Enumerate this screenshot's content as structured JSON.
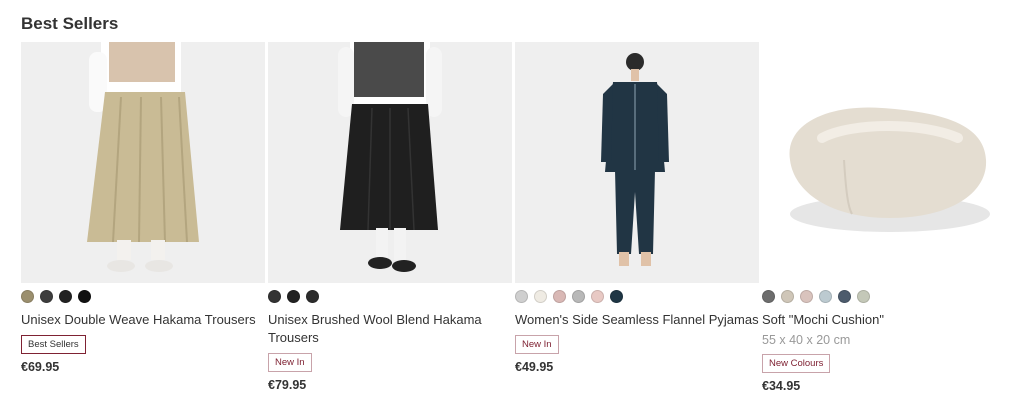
{
  "section": {
    "title": "Best Sellers"
  },
  "products": [
    {
      "name": "Unisex Double Weave Hakama Trousers",
      "swatches": [
        {
          "name": "beige",
          "color": "#9b8f6e"
        },
        {
          "name": "dark-grey",
          "color": "#3d3d3d"
        },
        {
          "name": "black",
          "color": "#222222"
        },
        {
          "name": "black",
          "color": "#111111"
        }
      ],
      "badge": "Best Sellers",
      "price": "€69.95"
    },
    {
      "name": "Unisex Brushed Wool Blend Hakama Trousers",
      "swatches": [
        {
          "name": "charcoal",
          "color": "#333333"
        },
        {
          "name": "black",
          "color": "#222222"
        },
        {
          "name": "dark-grey",
          "color": "#2c2c2c"
        }
      ],
      "badge": "New In",
      "price": "€79.95"
    },
    {
      "name": "Women's Side Seamless Flannel Pyjamas",
      "swatches": [
        {
          "name": "light-grey",
          "color": "#cfcfcf"
        },
        {
          "name": "off-white",
          "color": "#efebe3"
        },
        {
          "name": "pink-check",
          "color": "#d9b8b5"
        },
        {
          "name": "grey-check",
          "color": "#b8b8b8"
        },
        {
          "name": "light-pink",
          "color": "#e8c9c4"
        },
        {
          "name": "navy",
          "color": "#1f3645"
        }
      ],
      "badge": "New In",
      "price": "€49.95"
    },
    {
      "name": "Soft \"Mochi Cushion\"",
      "dims": "55 x 40 x 20 cm",
      "swatches": [
        {
          "name": "dark-grey",
          "color": "#6d6d6d"
        },
        {
          "name": "beige",
          "color": "#cfc6b8"
        },
        {
          "name": "pink",
          "color": "#d9c3bd"
        },
        {
          "name": "light-blue",
          "color": "#bccad0"
        },
        {
          "name": "navy",
          "color": "#4c5b6c"
        },
        {
          "name": "sage",
          "color": "#c4c8b8"
        }
      ],
      "badge": "New Colours",
      "price": "€34.95"
    }
  ]
}
